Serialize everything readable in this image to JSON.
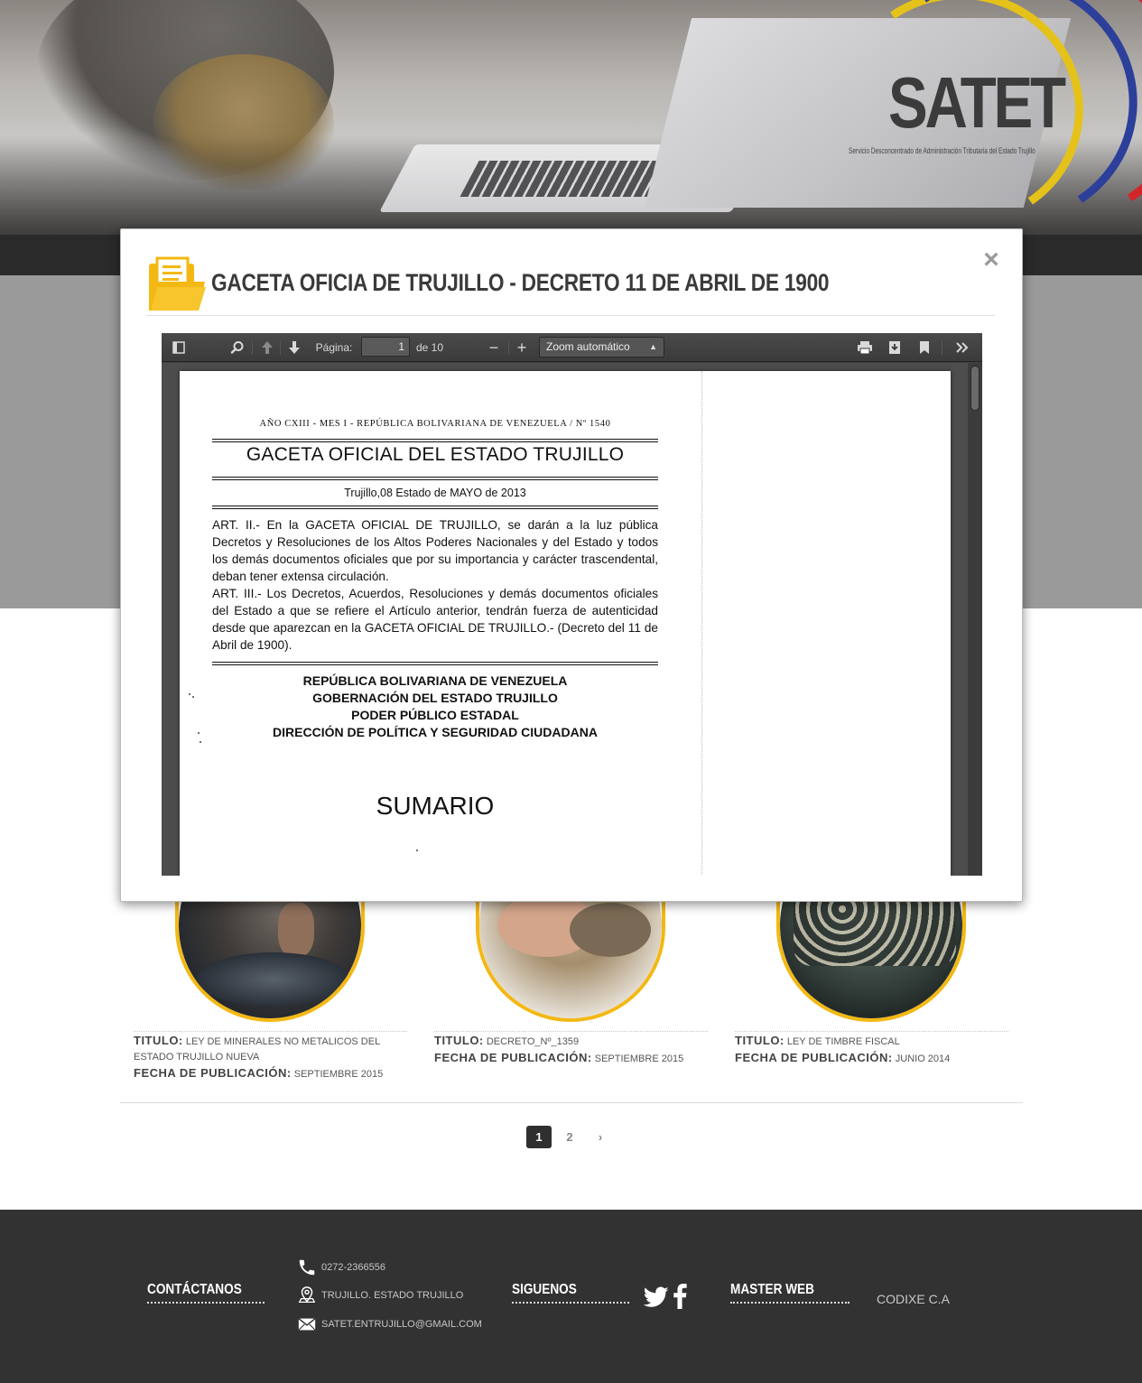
{
  "brand": {
    "logo_text": "SATET",
    "logo_subtitle": "Servicio Desconcentrado de Administración Tributaria del Estado Trujillo",
    "colors": {
      "yellow": "#e5c21a",
      "blue": "#2c3f9a",
      "red": "#d2262a",
      "accent": "#f3b813"
    }
  },
  "modal": {
    "title": "GACETA OFICIA DE TRUJILLO - DECRETO 11 DE ABRIL DE 1900",
    "close_symbol": "×",
    "icon": "folder-document-icon",
    "viewer": {
      "toolbar": {
        "sidebar_toggle_icon": "sidebar-toggle-icon",
        "search_icon": "search-icon",
        "prev_page_icon": "arrow-up-icon",
        "next_page_icon": "arrow-down-icon",
        "page_label": "Página:",
        "page_value": "1",
        "page_total": "de 10",
        "zoom_out": "−",
        "zoom_in": "+",
        "zoom_selected": "Zoom automático",
        "print_icon": "print-icon",
        "download_icon": "download-icon",
        "bookmark_icon": "bookmark-icon",
        "more_icon": "double-chevron-right-icon"
      },
      "document": {
        "header_line": "AÑO CXIII - MES I - REPÚBLICA BOLIVARIANA DE VENEZUELA / Nº 1540",
        "title": "GACETA OFICIAL DEL ESTADO TRUJILLO",
        "date_line": "Trujillo,08 Estado  de MAYO de 2013",
        "art_ii": "ART. II.- En la GACETA OFICIAL DE TRUJILLO, se darán a la luz pública Decretos y Resoluciones de los Altos Poderes Nacionales y del Estado y todos los demás documentos oficiales que por su importancia y carácter trascendental, deban tener extensa circulación.",
        "art_iii": "ART. III.- Los Decretos, Acuerdos, Resoluciones y demás documentos oficiales del Estado a que se refiere el Artículo anterior, tendrán fuerza de autenticidad desde que aparezcan en la GACETA OFICIAL DE TRUJILLO.- (Decreto del 11 de Abril de 1900).",
        "authority": [
          "REPÚBLICA BOLIVARIANA DE VENEZUELA",
          "GOBERNACIÓN DEL ESTADO TRUJILLO",
          "PODER PÚBLICO ESTADAL",
          "DIRECCIÓN DE POLÍTICA Y SEGURIDAD CIUDADANA"
        ],
        "sumario": "SUMARIO"
      }
    }
  },
  "cards": [
    {
      "title_key": "TITULO:",
      "title": "LEY DE MINERALES NO METALICOS DEL ESTADO TRUJILLO NUEVA",
      "date_key": "FECHA DE PUBLICACIÓN:",
      "date": "SEPTIEMBRE 2015"
    },
    {
      "title_key": "TITULO:",
      "title": "DECRETO_Nº_1359",
      "date_key": "FECHA DE PUBLICACIÓN:",
      "date": "SEPTIEMBRE 2015"
    },
    {
      "title_key": "TITULO:",
      "title": "LEY DE TIMBRE FISCAL",
      "date_key": "FECHA DE PUBLICACIÓN:",
      "date": "JUNIO 2014"
    }
  ],
  "pagination": {
    "pages": [
      "1",
      "2"
    ],
    "active": "1",
    "next": "›"
  },
  "footer": {
    "contact_heading": "CONTÁCTANOS",
    "phone": "0272-2366556",
    "address": "TRUJILLO. ESTADO TRUJILLO",
    "email": "SATET.ENTRUJILLO@GMAIL.COM",
    "follow_heading": "SIGUENOS",
    "social": [
      "twitter-icon",
      "facebook-icon"
    ],
    "master_heading": "MASTER WEB",
    "master_value": "CODIXE C.A"
  }
}
